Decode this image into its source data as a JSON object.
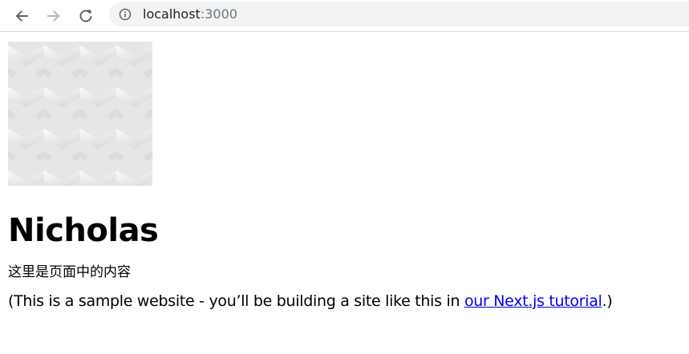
{
  "browser": {
    "url_host": "localhost",
    "url_port": ":3000",
    "icons": {
      "back": "arrow-left-icon",
      "forward": "arrow-right-icon",
      "reload": "reload-icon",
      "info": "info-circle-icon"
    }
  },
  "page": {
    "title": "Nicholas",
    "intro": "这里是页面中的内容",
    "sample_prefix": "(This is a sample website - you’ll be building a site like this in ",
    "tutorial_link": "our Next.js tutorial",
    "sample_suffix": ".)"
  },
  "colors": {
    "link": "#0000ee",
    "omnibox_bg": "#f1f3f4"
  }
}
